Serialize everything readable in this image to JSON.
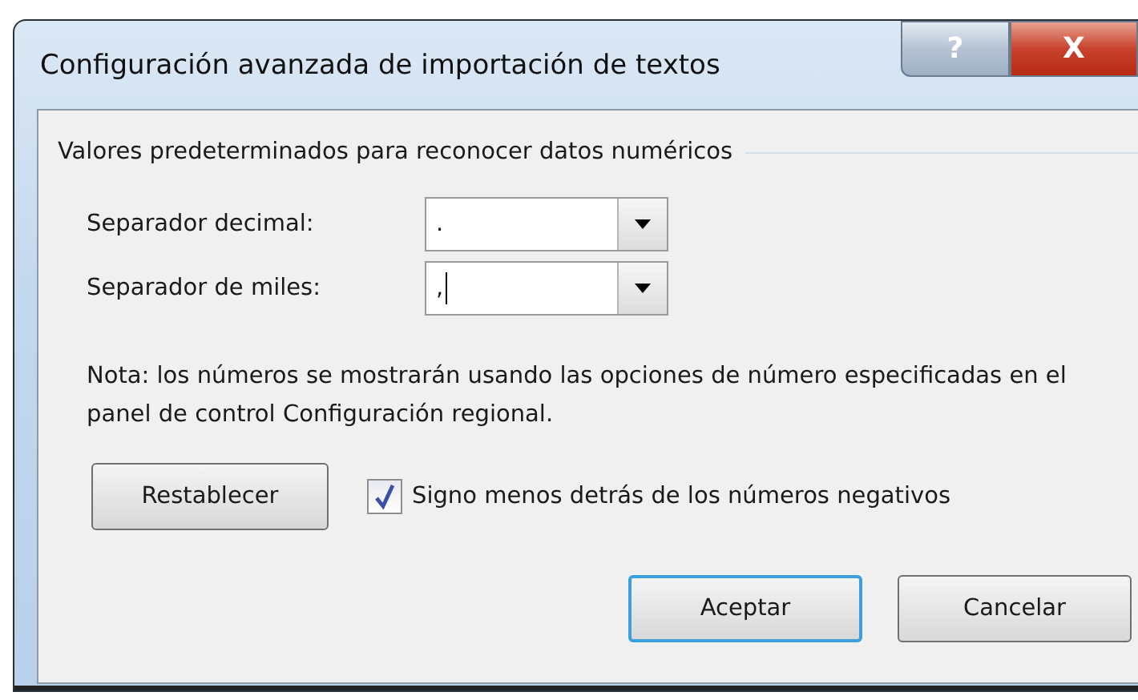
{
  "window": {
    "title": "Configuración avanzada de importación de textos",
    "title_buttons": [
      {
        "kind": "help",
        "label": "?"
      },
      {
        "kind": "close",
        "label": "X"
      }
    ]
  },
  "group": {
    "title": "Valores predeterminados para reconocer datos numéricos"
  },
  "fields": [
    {
      "label": "Separador decimal:",
      "value": ".",
      "focused": false
    },
    {
      "label": "Separador de miles:",
      "value": ",",
      "focused": true
    }
  ],
  "note": "Nota: los números se mostrarán usando las opciones de número especificadas en el panel de control Configuración regional.",
  "reset_button": "Restablecer",
  "checkbox": {
    "label": "Signo menos detrás de los números negativos",
    "checked": true
  },
  "buttons": [
    {
      "label": "Aceptar",
      "default": true
    },
    {
      "label": "Cancelar",
      "default": false
    }
  ]
}
